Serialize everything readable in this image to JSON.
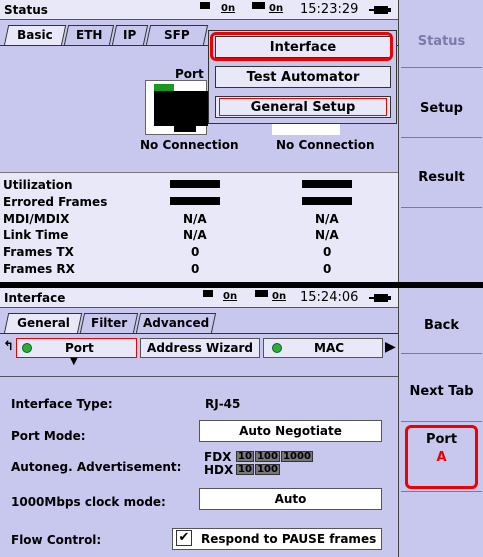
{
  "top": {
    "title": "Status",
    "ind_a": "0n",
    "ind_b": "0n",
    "time": "15:23:29",
    "tabs": [
      "Basic",
      "ETH",
      "IP",
      "SFP"
    ],
    "port_label": "Port",
    "conn_a": "No Connection",
    "conn_b": "No Connection",
    "menu": [
      "Interface",
      "Test Automator",
      "General Setup"
    ],
    "rows": [
      {
        "label": "Utilization",
        "a": "",
        "b": ""
      },
      {
        "label": "Errored Frames",
        "a": "",
        "b": ""
      },
      {
        "label": "MDI/MDIX",
        "a": "N/A",
        "b": "N/A"
      },
      {
        "label": "Link Time",
        "a": "N/A",
        "b": "N/A"
      },
      {
        "label": "Frames TX",
        "a": "0",
        "b": "0"
      },
      {
        "label": "Frames RX",
        "a": "0",
        "b": "0"
      }
    ],
    "side": [
      "Status",
      "Setup",
      "Result"
    ]
  },
  "bottom": {
    "title": "Interface",
    "ind_a": "0n",
    "ind_b": "0n",
    "time": "15:24:06",
    "tabs": [
      "General",
      "Filter",
      "Advanced"
    ],
    "subtabs": [
      "Port",
      "Address Wizard",
      "MAC"
    ],
    "fields": {
      "iface_label": "Interface Type:",
      "iface_value": "RJ-45",
      "mode_label": "Port Mode:",
      "mode_value": "Auto Negotiate",
      "adv_label": "Autoneg. Advertisement:",
      "fdx": "FDX",
      "hdx": "HDX",
      "fdx_cells": [
        "10",
        "100",
        "1000"
      ],
      "hdx_cells": [
        "10",
        "100"
      ],
      "clock_label": "1000Mbps clock mode:",
      "clock_value": "Auto",
      "flow_label": "Flow Control:",
      "flow_value": "Respond to PAUSE frames"
    },
    "side": [
      "Back",
      "Next Tab",
      "Port",
      "A"
    ]
  }
}
